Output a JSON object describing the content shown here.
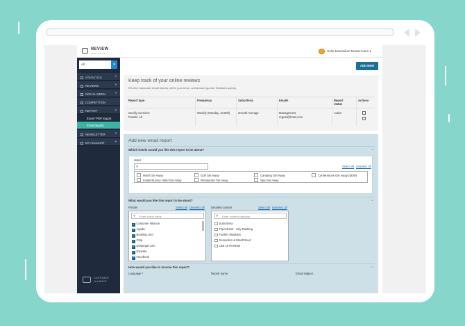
{
  "colors": {
    "background": "#86d6cc",
    "sidebar": "#1f2a3c",
    "accent": "#3bb4a6",
    "primary_button": "#1c6f95"
  },
  "brand": {
    "title": "REVIEW",
    "subtitle": "ANALYTICS"
  },
  "user": {
    "name": "Hello Maximilian Mustermann",
    "caret": "▾"
  },
  "sidebar": {
    "filter": {
      "value": "All",
      "button": "▾"
    },
    "items": [
      {
        "label": "STATISTICS"
      },
      {
        "label": "REVIEWS"
      },
      {
        "label": "SOCIAL MEDIA"
      },
      {
        "label": "COMPETITION"
      },
      {
        "label": "REPORT"
      }
    ],
    "subitems": [
      {
        "label": "Excel / PDF Export"
      },
      {
        "label": "Email reports"
      }
    ],
    "items_after": [
      {
        "label": "NEWSLETTER"
      },
      {
        "label": "MY ACCOUNT"
      }
    ],
    "footer": {
      "line1": "CUSTOMER",
      "line2": "ALLIANCE"
    }
  },
  "main": {
    "add_new_label": "ADD NEW",
    "reports": {
      "title": "Keep track of your online reviews",
      "subtitle": "Receive automatic email reports, direct your team, and answer guests' feedback quickly.",
      "columns": [
        "Report type",
        "Frequency",
        "Subcriteria",
        "Emails",
        "Report status",
        "Actions"
      ],
      "row": {
        "type": "weekly overview",
        "portals": "Portals: All",
        "frequency": "Weekly (Monday, 10:00h)",
        "subcriteria": "Overall Average",
        "emails_1": "Management",
        "emails_2": "regnst@hotel.com",
        "status": "Active"
      }
    },
    "add_report": {
      "title": "Add new email report",
      "hotels": {
        "question": "Which hotels would you like this report to be about?",
        "label": "Hotel",
        "select_all": "Select All",
        "unselect_all": "Unselect All",
        "options": [
          "Hotel Get Away",
          "Golf Get Away",
          "Camping Get Away",
          "Conferences Get Away (SEW)",
          "InstantSurvey Hotel Get Away",
          "Restaurant Get Away",
          "Spa Get Away"
        ]
      },
      "content": {
        "question": "What would you like this report to be about?",
        "portals_label": "Portals",
        "portals_select_all": "Select all",
        "portals_deselect_all": "Deselect all",
        "portals_placeholder": "Enter portal name",
        "portals": [
          "Customer Alliance",
          "Agoda",
          "Booking.com",
          "Ctrip",
          "Despegar.com",
          "Expedia",
          "Facebook"
        ],
        "detailed_label": "Detailed content",
        "detailed_select_all": "Select all",
        "detailed_deselect_all": "Deselect all",
        "detailed_placeholder": "Enter content category",
        "detailed": [
          "Subcriteria",
          "TripAdvisor - City Ranking",
          "Further Statistics",
          "Semantics & WordCloud",
          "Last 10 Reviews"
        ]
      },
      "receive": {
        "question": "How would you like to receive this report?",
        "language_label": "Language *",
        "report_name_label": "Report name",
        "email_subject_label": "Email subject"
      }
    }
  }
}
